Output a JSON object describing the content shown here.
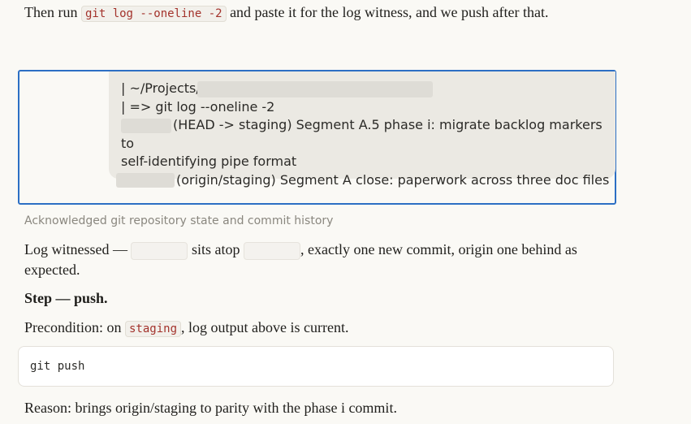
{
  "intro": {
    "before": "Then run ",
    "code": "git log --oneline -2",
    "after": " and paste it for the log witness, and we push after that."
  },
  "user_message": {
    "line1": "| ~/Projects/",
    "line2": "| => git log --oneline -2",
    "commit1_msg": "(HEAD -> staging) Segment A.5 phase i: migrate backlog markers to",
    "commit1_cont": "self-identifying pipe format",
    "commit2_msg": "(origin/staging) Segment A close: paperwork across three doc files"
  },
  "thinking_summary": "Acknowledged git repository state and commit history",
  "witness": {
    "prefix": "Log witnessed — ",
    "mid": " sits atop ",
    "suffix": ", exactly one new commit, origin one behind as expected."
  },
  "step_heading": "Step — push.",
  "precondition": {
    "before": "Precondition: on ",
    "code": "staging",
    "after": ", log output above is current."
  },
  "code_block": "git push",
  "reason": "Reason: brings origin/staging to parity with the phase i commit."
}
